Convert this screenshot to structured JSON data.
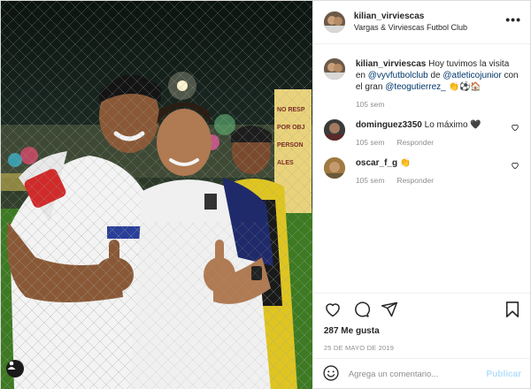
{
  "header": {
    "username": "kilian_virviescas",
    "location": "Vargas & Virviescas Futbol Club",
    "more_label": "•••"
  },
  "caption": {
    "username": "kilian_virviescas",
    "text_before": "Hoy tuvimos la visita en ",
    "mention_1": "@vyvfutbolclub",
    "text_mid_1": " de ",
    "mention_2": "@atleticojunior",
    "text_mid_2": " con el gran ",
    "mention_3": "@teogutierrez_",
    "emojis": "👏⚽🏠",
    "time": "105 sem"
  },
  "comments": [
    {
      "username": "dominguez3350",
      "text": "Lo máximo 🖤",
      "time": "105 sem",
      "reply_label": "Responder"
    },
    {
      "username": "oscar_f_g",
      "text": "👏",
      "time": "105 sem",
      "reply_label": "Responder"
    }
  ],
  "likes": "287 Me gusta",
  "date": "25 DE MAYO DE 2019",
  "add_comment": {
    "placeholder": "Agrega un comentario...",
    "post_label": "Publicar"
  },
  "photo": {
    "sign_text": "NO RESPONDE POR OBJETOS PERSONALES"
  },
  "icons": [
    "heart-icon",
    "comment-icon",
    "share-icon",
    "bookmark-icon",
    "emoji-icon",
    "tag-user-icon",
    "more-icon"
  ],
  "colors": {
    "link": "#00376b",
    "muted": "#8e8e8e",
    "publish_disabled": "#b2dffc"
  }
}
